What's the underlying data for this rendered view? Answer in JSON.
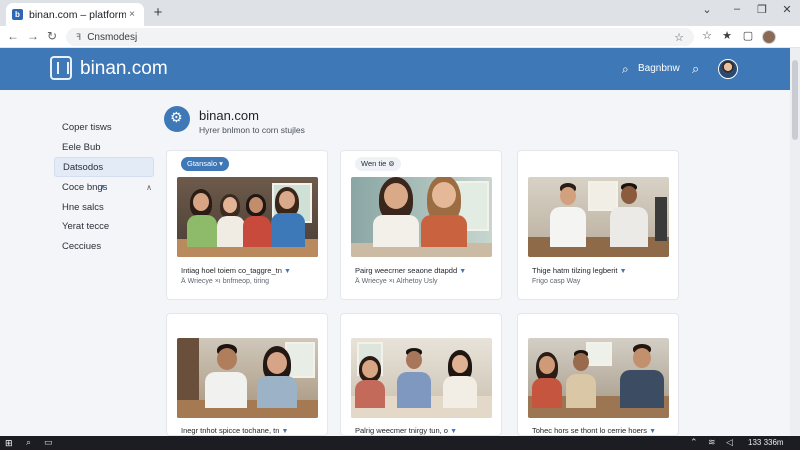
{
  "browser": {
    "tab_title": "binan.com – platform",
    "tab_close": "×",
    "new_tab": "+",
    "address": "Cnsmodesj"
  },
  "header": {
    "logo_text": "binan.com",
    "link_label": "Bagnbnw"
  },
  "sidebar": {
    "items": [
      {
        "label": "Coper tisws"
      },
      {
        "label": "Eele Bub"
      },
      {
        "label": "Datsodos"
      },
      {
        "label": "Coce bngs"
      },
      {
        "label": "Hne salcs"
      },
      {
        "label": "Yerat tecce"
      },
      {
        "label": "Cecciues"
      }
    ]
  },
  "page": {
    "title": "binan.com",
    "subtitle": "Hyrer bnlmon to corn stujles"
  },
  "cards": [
    {
      "badge": "Gtansalo",
      "title": "Intiag hoel toiem co_taggre_tn",
      "meta": "Ä Wriecye ×ı bnfmeop, tiring"
    },
    {
      "badge": "Wen tie",
      "title": "Pairg weecrner seaone dtapdd",
      "meta": "Ä Wriecye ×ı Alrhetoy Usly"
    },
    {
      "badge": "",
      "title": "Thige hatm tilzing legberit",
      "meta": "Frigo casp Way"
    },
    {
      "badge": "",
      "title": "Inegr tnhot spicce tochane, tn",
      "meta": ""
    },
    {
      "badge": "",
      "title": "Palrig weecmer tnirgy tun, o",
      "meta": ""
    },
    {
      "badge": "",
      "title": "Tohec hors se thont lo cerrie hoers",
      "meta": ""
    }
  ],
  "taskbar": {
    "clock": "133 336m"
  },
  "colors": {
    "header": "#3f78b6",
    "accent": "#3f78b6",
    "page_bg": "#f3f5f8"
  }
}
